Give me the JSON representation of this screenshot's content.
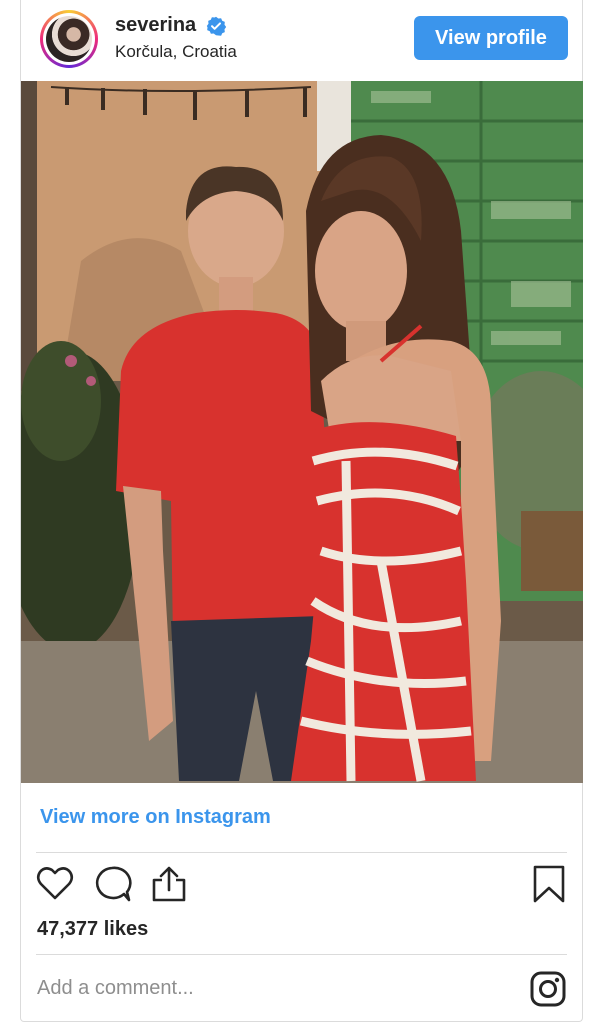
{
  "post": {
    "username": "severina",
    "location": "Korčula, Croatia",
    "view_profile_label": "View profile",
    "view_more_label": "View more on Instagram",
    "likes_text": "47,377 likes",
    "comment_placeholder": "Add a comment..."
  },
  "icons": {
    "verified": "verified-badge-icon",
    "like": "heart-icon",
    "comment": "comment-bubble-icon",
    "share": "share-icon",
    "save": "bookmark-icon",
    "instagram": "instagram-logo-icon"
  },
  "colors": {
    "accent": "#3b95ec",
    "text": "#262626",
    "muted": "#8e8e8e",
    "divider": "#dbdbdb"
  }
}
